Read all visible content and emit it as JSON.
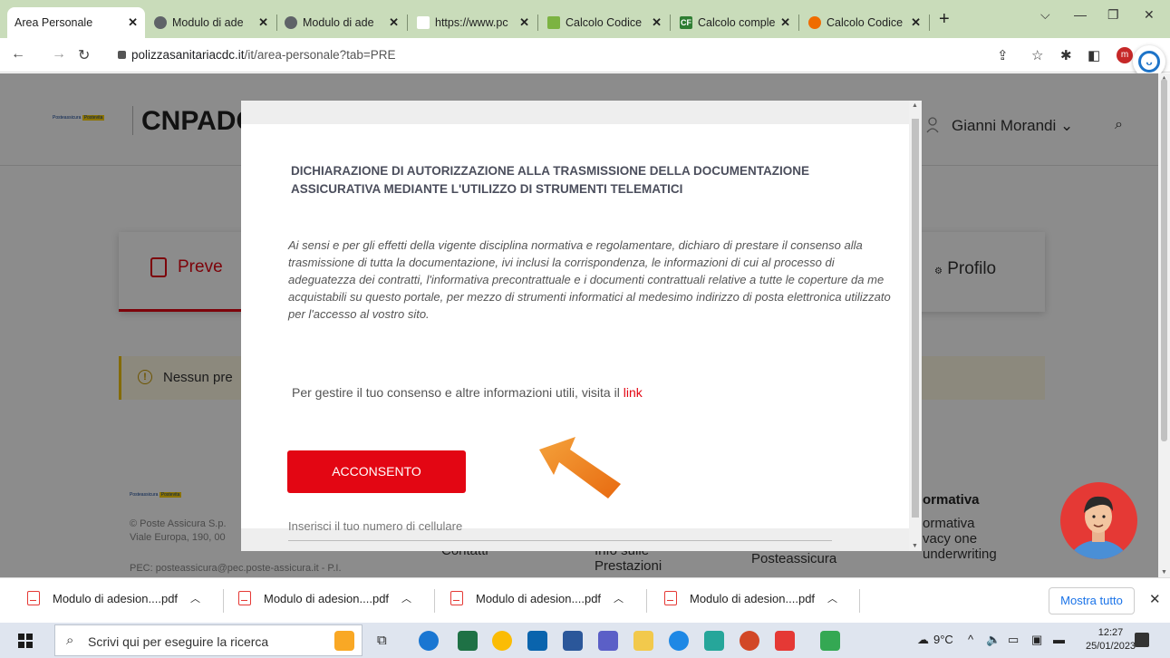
{
  "browser": {
    "tabs": [
      {
        "title": "Area Personale",
        "color": "#ffffff",
        "active": true
      },
      {
        "title": "Modulo di ade",
        "color": "#5f6368"
      },
      {
        "title": "Modulo di ade",
        "color": "#5f6368"
      },
      {
        "title": "https://www.pc",
        "color": "#ffffff"
      },
      {
        "title": "Calcolo Codice",
        "color": "#7cb342"
      },
      {
        "title": "Calcolo comple",
        "color": "#2e7d32",
        "badge": "CF"
      },
      {
        "title": "Calcolo Codice",
        "color": "#ef6c00"
      }
    ],
    "close_glyph": "✕",
    "new_tab_glyph": "+",
    "url_host": "polizzasanitariacdc.it",
    "url_path": "/it/area-personale?tab=PRE",
    "profile_initial": "m"
  },
  "site": {
    "brand": "CNPADC",
    "logo_text": "Posteassicura",
    "logo_badge": "Postevita",
    "user_name": "Gianni Morandi",
    "tab_active_label": "Preventivi",
    "tab_active_visible": "Preve",
    "tab_profile_label": "Profilo",
    "notice_text": "Nessun pre",
    "footer": {
      "copyright": "© Poste Assicura S.p.",
      "address": "Viale Europa, 190, 00",
      "pec": "PEC: posteassicura@pec.poste-assicura.it - P.I.",
      "col_contatti": "Contatti",
      "col_info": "Info sulle",
      "col_prestazioni": "Prestazioni",
      "col_posteassicura": "Posteassicura",
      "col_normativa_head": "ormativa",
      "col_normativa_1": "ormativa",
      "col_normativa_2": "vacy one",
      "col_normativa_3": "underwriting"
    }
  },
  "modal": {
    "title": "DICHIARAZIONE DI AUTORIZZAZIONE ALLA TRASMISSIONE DELLA DOCUMENTAZIONE ASSICURATIVA MEDIANTE L'UTILIZZO DI STRUMENTI TELEMATICI",
    "body": "Ai sensi e per gli effetti della vigente disciplina normativa e regolamentare, dichiaro di prestare il consenso alla trasmissione di tutta la documentazione, ivi inclusi la corrispondenza, le informazioni di cui al processo di adeguatezza dei contratti, l'informativa precontrattuale e i documenti contrattuali relative a tutte le coperture da me acquistabili su questo portale, per mezzo di strumenti informatici al medesimo indirizzo di posta elettronica utilizzato per l'accesso al vostro sito.",
    "consent_text": "Per gestire il tuo consenso e altre informazioni utili, visita il",
    "consent_link": "link",
    "accept_button": "ACCONSENTO",
    "behind_input_placeholder": "Inserisci il tuo numero di cellulare"
  },
  "downloads": {
    "items": [
      "Modulo di adesion....pdf",
      "Modulo di adesion....pdf",
      "Modulo di adesion....pdf",
      "Modulo di adesion....pdf"
    ],
    "show_all": "Mostra tutto"
  },
  "taskbar": {
    "search_placeholder": "Scrivi qui per eseguire la ricerca",
    "temperature": "9°C",
    "time": "12:27",
    "date": "25/01/2023"
  },
  "colors": {
    "accent_red": "#e30613",
    "tab_strip": "#c9dcba",
    "arrow_orange": "#f07a1a"
  }
}
